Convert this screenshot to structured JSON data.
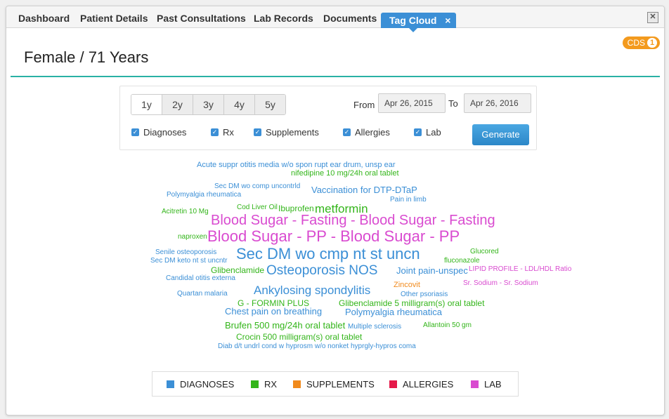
{
  "tabs": [
    {
      "label": "Dashboard"
    },
    {
      "label": "Patient Details"
    },
    {
      "label": "Past Consultations"
    },
    {
      "label": "Lab Records"
    },
    {
      "label": "Documents"
    },
    {
      "label": "Tag Cloud",
      "active": true
    }
  ],
  "tab_close_glyph": "×",
  "window_close_glyph": "✕",
  "cds": {
    "label": "CDS",
    "count": "1"
  },
  "patient_title": "Female / 71 Years",
  "filters": {
    "ranges": [
      "1y",
      "2y",
      "3y",
      "4y",
      "5y"
    ],
    "selected_range": "1y",
    "from_label": "From",
    "from_value": "Apr 26, 2015",
    "to_label": "To",
    "to_value": "Apr 26, 2016",
    "checkboxes": [
      {
        "label": "Diagnoses",
        "checked": true
      },
      {
        "label": "Rx",
        "checked": true
      },
      {
        "label": "Supplements",
        "checked": true
      },
      {
        "label": "Allergies",
        "checked": true
      },
      {
        "label": "Lab",
        "checked": true
      }
    ],
    "generate_label": "Generate"
  },
  "colors": {
    "diagnoses": "#3b8fd6",
    "rx": "#33b51a",
    "supplements": "#f18a1c",
    "allergies": "#e5194a",
    "lab": "#d94bd0"
  },
  "tag_cloud": [
    {
      "text": "Acute suppr otitis media w/o spon rupt ear drum, unsp ear",
      "cat": "diagnoses"
    },
    {
      "text": "nifedipine 10 mg/24h oral tablet",
      "cat": "rx"
    },
    {
      "text": "Sec DM wo comp uncontrld",
      "cat": "diagnoses"
    },
    {
      "text": "Vaccination for DTP-DTaP",
      "cat": "diagnoses"
    },
    {
      "text": "Polymyalgia rheumatica",
      "cat": "diagnoses"
    },
    {
      "text": "Pain in limb",
      "cat": "diagnoses"
    },
    {
      "text": "Cod Liver Oil",
      "cat": "rx"
    },
    {
      "text": "Ibuprofen",
      "cat": "rx"
    },
    {
      "text": "metformin",
      "cat": "rx"
    },
    {
      "text": "Acitretin 10 Mg",
      "cat": "rx"
    },
    {
      "text": "Blood Sugar - Fasting - Blood Sugar - Fasting",
      "cat": "lab"
    },
    {
      "text": "naproxen",
      "cat": "rx"
    },
    {
      "text": "Blood Sugar - PP - Blood Sugar - PP",
      "cat": "lab"
    },
    {
      "text": "Senile osteoporosis",
      "cat": "diagnoses"
    },
    {
      "text": "Sec DM wo cmp nt st uncn",
      "cat": "diagnoses"
    },
    {
      "text": "Glucored",
      "cat": "rx"
    },
    {
      "text": "Sec DM keto nt st uncntr",
      "cat": "diagnoses"
    },
    {
      "text": "fluconazole",
      "cat": "rx"
    },
    {
      "text": "Glibenclamide",
      "cat": "rx"
    },
    {
      "text": "Osteoporosis NOS",
      "cat": "diagnoses"
    },
    {
      "text": "Joint pain-unspec",
      "cat": "diagnoses"
    },
    {
      "text": "LIPID PROFILE - LDL/HDL Ratio",
      "cat": "lab"
    },
    {
      "text": "Candidal otitis externa",
      "cat": "diagnoses"
    },
    {
      "text": "Zincovit",
      "cat": "supplements"
    },
    {
      "text": "Sr. Sodium - Sr. Sodium",
      "cat": "lab"
    },
    {
      "text": "Ankylosing spondylitis",
      "cat": "diagnoses"
    },
    {
      "text": "Quartan malaria",
      "cat": "diagnoses"
    },
    {
      "text": "Other psoriasis",
      "cat": "diagnoses"
    },
    {
      "text": "G - FORMIN PLUS",
      "cat": "rx"
    },
    {
      "text": "Glibenclamide 5 milligram(s) oral tablet",
      "cat": "rx"
    },
    {
      "text": "Chest pain on breathing",
      "cat": "diagnoses"
    },
    {
      "text": "Polymyalgia rheumatica",
      "cat": "diagnoses"
    },
    {
      "text": "Brufen 500 mg/24h oral tablet",
      "cat": "rx"
    },
    {
      "text": "Multiple sclerosis",
      "cat": "diagnoses"
    },
    {
      "text": "Allantoin 50 gm",
      "cat": "rx"
    },
    {
      "text": "Crocin 500 milligram(s) oral tablet",
      "cat": "rx"
    },
    {
      "text": "Diab d/t undrl cond w hyprosm w/o nonket hyprgly-hypros coma",
      "cat": "diagnoses"
    }
  ],
  "legend": [
    {
      "label": "DIAGNOSES",
      "cat": "diagnoses"
    },
    {
      "label": "RX",
      "cat": "rx"
    },
    {
      "label": "SUPPLEMENTS",
      "cat": "supplements"
    },
    {
      "label": "ALLERGIES",
      "cat": "allergies"
    },
    {
      "label": "LAB",
      "cat": "lab"
    }
  ]
}
